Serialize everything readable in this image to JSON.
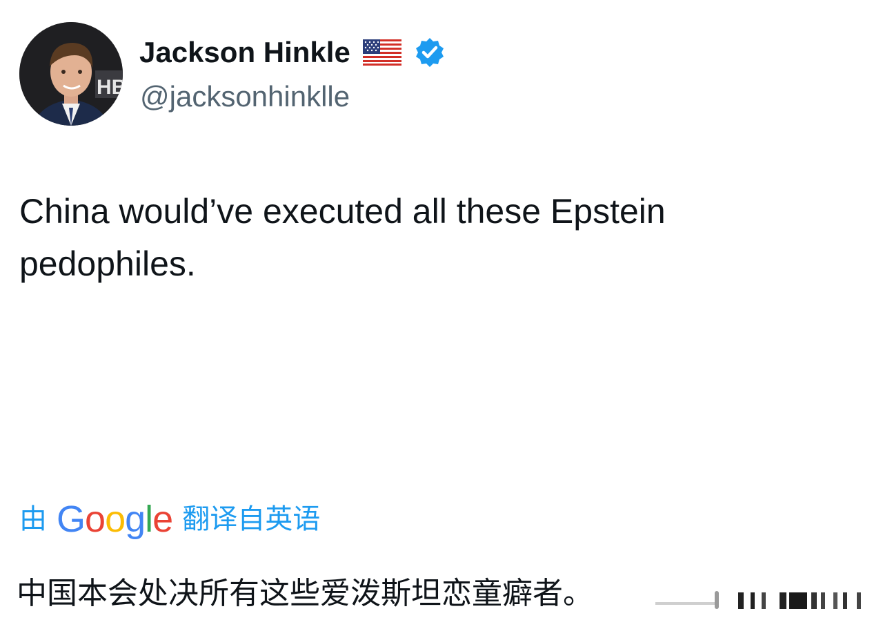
{
  "author": {
    "display_name": "Jackson Hinkle",
    "handle": "@jacksonhinklle",
    "avatar_text": "HB"
  },
  "tweet": {
    "text": "China would’ve executed all these Epstein pedophiles."
  },
  "translation": {
    "by_label": "由",
    "provider_letters": [
      "G",
      "o",
      "o",
      "g",
      "l",
      "e"
    ],
    "from_label": "翻译自英语",
    "text": "中国本会处决所有这些爱泼斯坦恋童癖者。"
  },
  "icons": {
    "flag": "us-flag-icon",
    "verified": "verified-badge-icon",
    "google": "google-logo"
  },
  "colors": {
    "accent": "#1d9bf0",
    "handle": "#536471",
    "text": "#0f1419",
    "google_blue": "#4285f4",
    "google_red": "#ea4335",
    "google_yellow": "#fbbc05",
    "google_green": "#34a853"
  }
}
